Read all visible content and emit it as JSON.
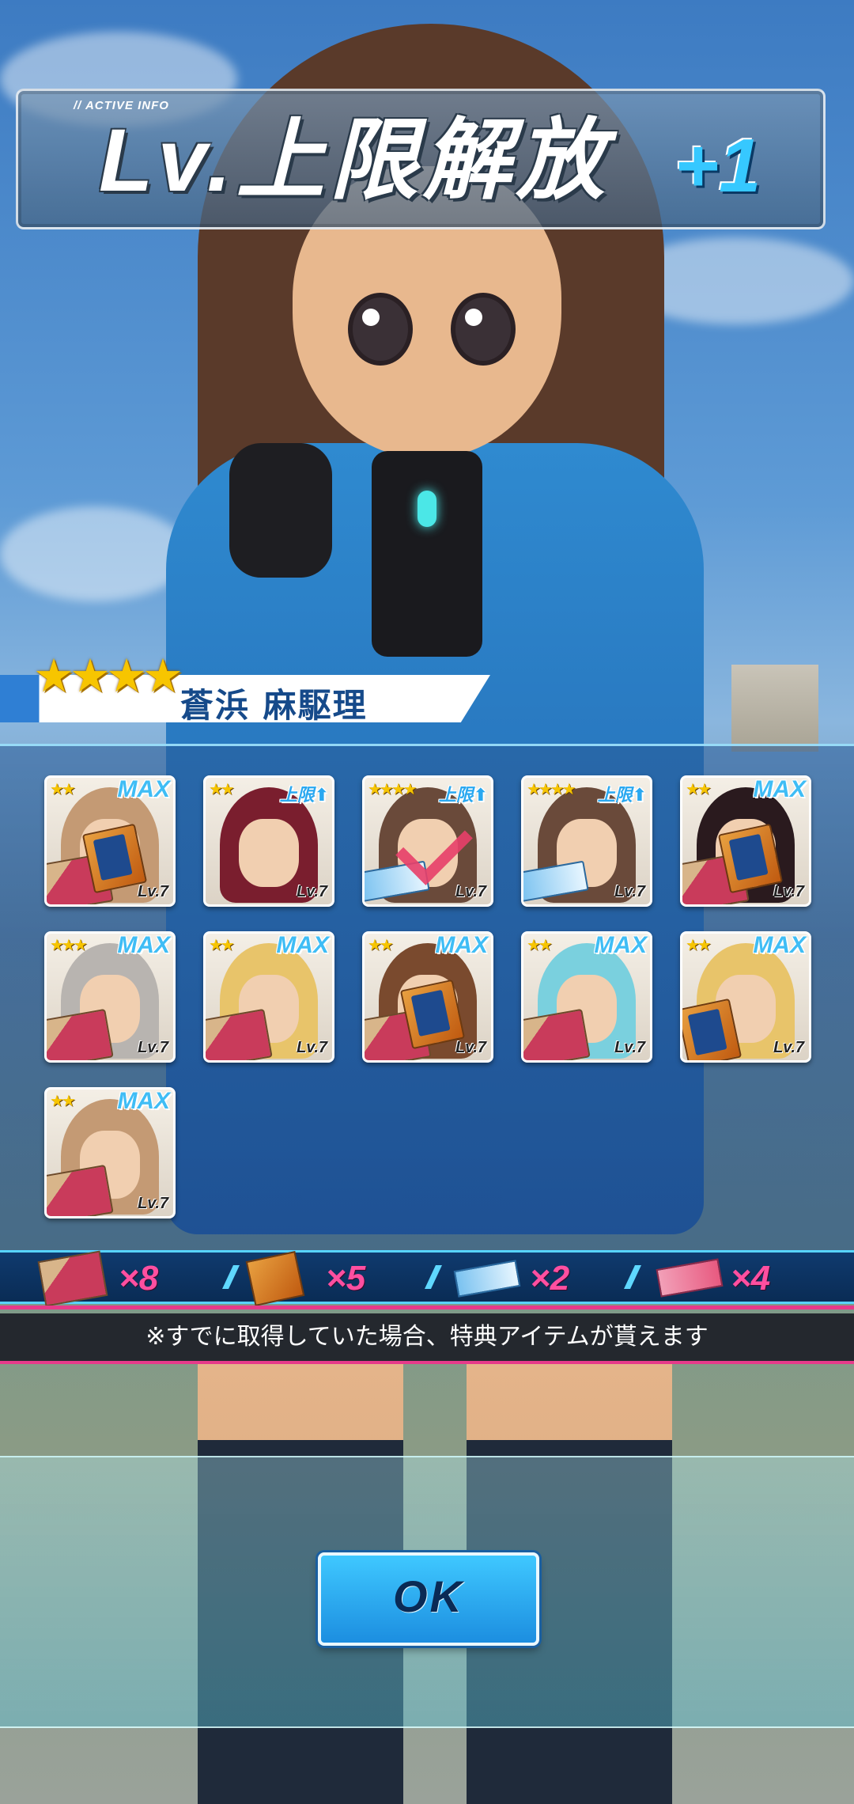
{
  "banner": {
    "tag": "// ACTIVE INFO",
    "title": "Lv.上限解放",
    "plus": "+1"
  },
  "character": {
    "rarity": "★★★★",
    "name": "蒼浜 麻駆理"
  },
  "cards": [
    {
      "stars": "★★",
      "badge": "MAX",
      "lv": "Lv.7",
      "hair": "#c49a74",
      "item": "meat",
      "item2": "card"
    },
    {
      "stars": "★★",
      "badge": "上限⬆",
      "lv": "Lv.7",
      "hair": "#7a1e2e",
      "item": "none"
    },
    {
      "stars": "★★★★",
      "badge": "上限⬆",
      "lv": "Lv.7",
      "hair": "#6a4a3a",
      "item": "ticket",
      "checked": true
    },
    {
      "stars": "★★★★",
      "badge": "上限⬆",
      "lv": "Lv.7",
      "hair": "#6a4a3a",
      "item": "ticket"
    },
    {
      "stars": "★★",
      "badge": "MAX",
      "lv": "Lv.7",
      "hair": "#2a1a1e",
      "item": "meat",
      "item2": "card"
    },
    {
      "stars": "★★★",
      "badge": "MAX",
      "lv": "Lv.7",
      "hair": "#b8b4b0",
      "item": "meat"
    },
    {
      "stars": "★★",
      "badge": "MAX",
      "lv": "Lv.7",
      "hair": "#e8c46a",
      "item": "meat"
    },
    {
      "stars": "★★",
      "badge": "MAX",
      "lv": "Lv.7",
      "hair": "#7a4a2e",
      "item": "meat",
      "item2": "card"
    },
    {
      "stars": "★★",
      "badge": "MAX",
      "lv": "Lv.7",
      "hair": "#7ad0de",
      "item": "meat"
    },
    {
      "stars": "★★",
      "badge": "MAX",
      "lv": "Lv.7",
      "hair": "#e8c46a",
      "item": "card"
    },
    {
      "stars": "★★",
      "badge": "MAX",
      "lv": "Lv.7",
      "hair": "#c49a74",
      "item": "meat"
    }
  ],
  "totals": [
    {
      "icon": "meat-box-icon",
      "count": "×8"
    },
    {
      "icon": "card-item-icon",
      "count": "×5"
    },
    {
      "icon": "ticket-icon",
      "count": "×2"
    },
    {
      "icon": "coupon-icon",
      "count": "×4"
    }
  ],
  "notice": "※すでに取得していた場合、特典アイテムが貰えます",
  "ok_label": "OK",
  "colors": {
    "accent": "#36c8ff",
    "pink": "#ff4fa0",
    "gold": "#f7c500"
  }
}
